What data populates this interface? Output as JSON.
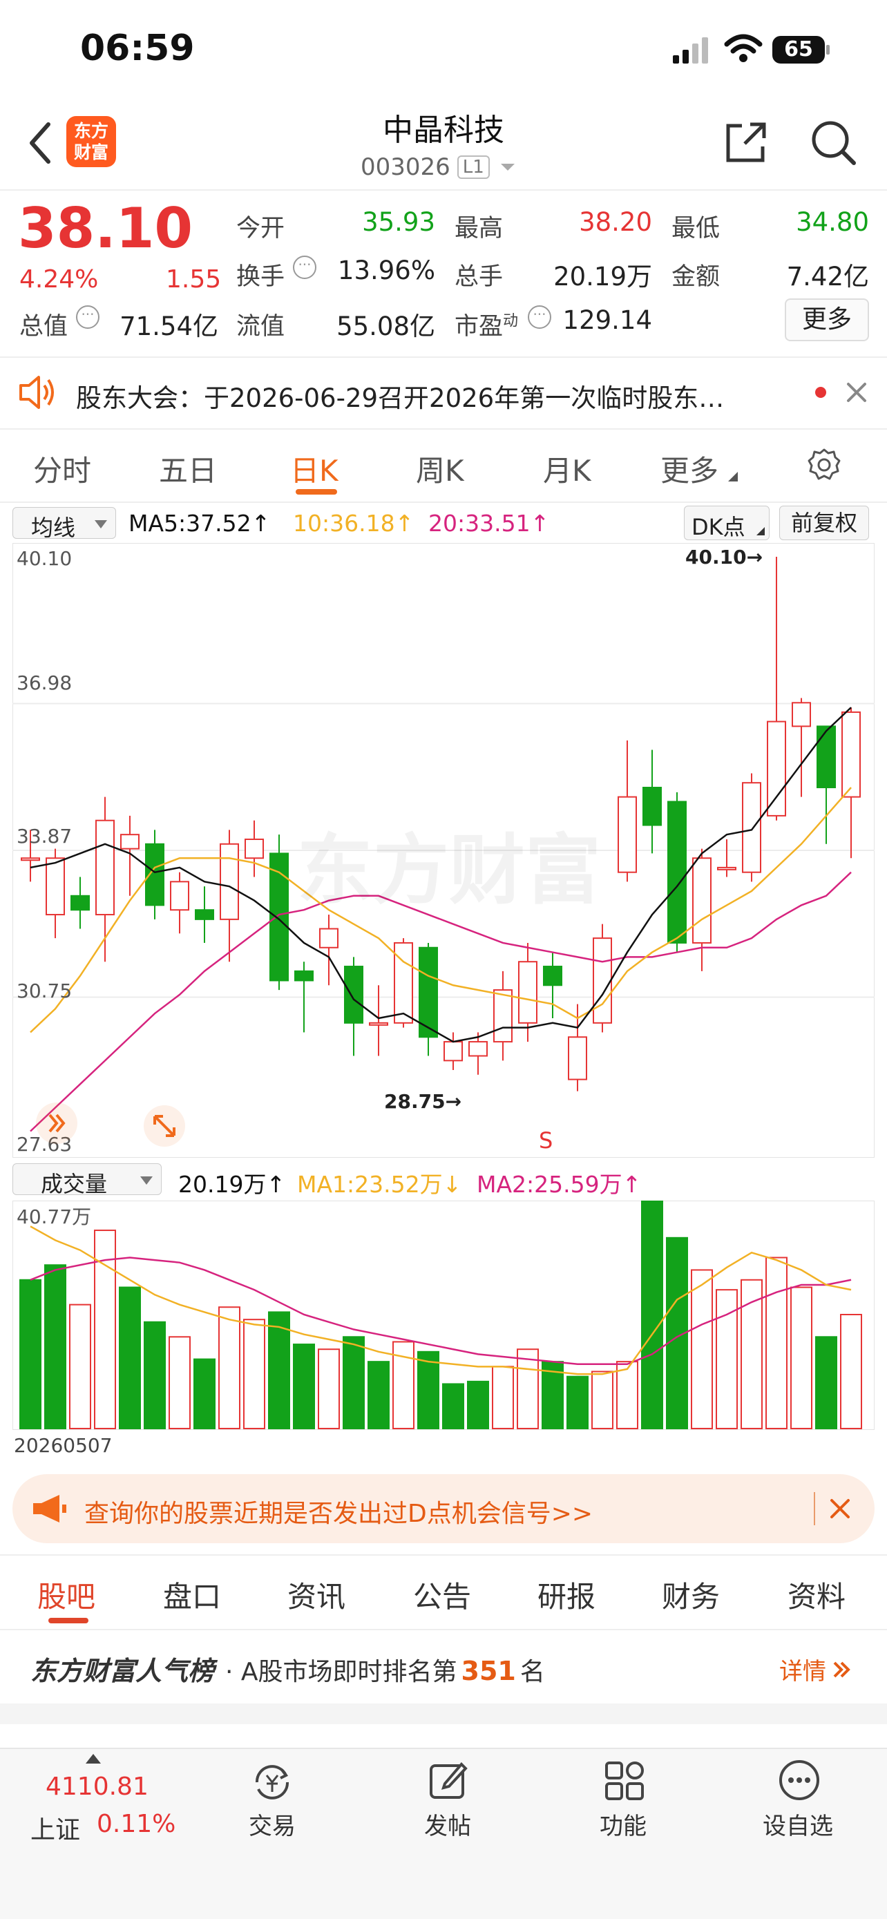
{
  "status_bar": {
    "time": "06:59",
    "battery": "65"
  },
  "header": {
    "logo_text": "东方\n财富",
    "title": "中晶科技",
    "code": "003026",
    "level_badge": "L1"
  },
  "quote": {
    "price": "38.10",
    "change_pct": "4.24%",
    "change": "1.55",
    "open_label": "今开",
    "open_value": "35.93",
    "high_label": "最高",
    "high_value": "38.20",
    "low_label": "最低",
    "low_value": "34.80",
    "turnover_label": "换手",
    "turnover_value": "13.96%",
    "volume_label": "总手",
    "volume_value": "20.19万",
    "amount_label": "金额",
    "amount_value": "7.42亿",
    "mktcap_label": "总值",
    "mktcap_value": "71.54亿",
    "float_label": "流值",
    "float_value": "55.08亿",
    "pe_label": "市盈",
    "pe_sup": "动",
    "pe_value": "129.14",
    "more_button": "更多"
  },
  "notice": {
    "text": "股东大会：于2026-06-29召开2026年第一次临时股东…"
  },
  "chart_tabs": {
    "items": [
      "分时",
      "五日",
      "日K",
      "周K",
      "月K",
      "更多"
    ],
    "active": "日K"
  },
  "ma_legend": {
    "selector": "均线",
    "ma5": "MA5:37.52↑",
    "ma10": "10:36.18↑",
    "ma20": "20:33.51↑",
    "dk_button": "DK点",
    "adjust_button": "前复权"
  },
  "price_axis": [
    "40.10",
    "36.98",
    "33.87",
    "30.75",
    "27.63"
  ],
  "annotations": {
    "high_mark": "40.10→",
    "low_mark": "28.75→",
    "signal": "S",
    "watermark": "东方财富"
  },
  "volume_legend": {
    "selector": "成交量",
    "vol": "20.19万↑",
    "ma1": "MA1:23.52万↓",
    "ma2": "MA2:25.59万↑",
    "max_label": "40.77万",
    "date_label": "20260507"
  },
  "colors": {
    "up": "#e63434",
    "down": "#12a21a",
    "ma5": "#111111",
    "ma10": "#f2b125",
    "ma20": "#d6237e",
    "accent": "#ff5a00"
  },
  "chart_data": {
    "type": "candlestick",
    "ylim": [
      27.63,
      40.1
    ],
    "candles": [
      {
        "o": 33.7,
        "c": 33.7,
        "h": 34.3,
        "l": 33.2
      },
      {
        "o": 32.5,
        "c": 33.7,
        "h": 33.9,
        "l": 32.0
      },
      {
        "o": 32.9,
        "c": 32.6,
        "h": 33.3,
        "l": 32.2
      },
      {
        "o": 32.5,
        "c": 34.5,
        "h": 35.0,
        "l": 31.5
      },
      {
        "o": 33.9,
        "c": 34.2,
        "h": 34.6,
        "l": 32.9
      },
      {
        "o": 34.0,
        "c": 32.7,
        "h": 34.3,
        "l": 32.4
      },
      {
        "o": 32.6,
        "c": 33.2,
        "h": 33.4,
        "l": 32.1
      },
      {
        "o": 32.6,
        "c": 32.4,
        "h": 33.1,
        "l": 31.9
      },
      {
        "o": 32.4,
        "c": 34.0,
        "h": 34.3,
        "l": 31.5
      },
      {
        "o": 33.7,
        "c": 34.1,
        "h": 34.5,
        "l": 33.3
      },
      {
        "o": 33.8,
        "c": 31.1,
        "h": 34.2,
        "l": 30.9
      },
      {
        "o": 31.3,
        "c": 31.1,
        "h": 31.5,
        "l": 30.0
      },
      {
        "o": 31.8,
        "c": 32.2,
        "h": 32.5,
        "l": 31.0
      },
      {
        "o": 31.4,
        "c": 30.2,
        "h": 31.6,
        "l": 29.5
      },
      {
        "o": 30.2,
        "c": 30.2,
        "h": 31.0,
        "l": 29.5
      },
      {
        "o": 30.2,
        "c": 31.9,
        "h": 32.0,
        "l": 30.1
      },
      {
        "o": 31.8,
        "c": 29.9,
        "h": 31.9,
        "l": 29.5
      },
      {
        "o": 29.4,
        "c": 29.8,
        "h": 30.0,
        "l": 29.2
      },
      {
        "o": 29.5,
        "c": 29.8,
        "h": 30.0,
        "l": 29.1
      },
      {
        "o": 29.8,
        "c": 30.9,
        "h": 31.3,
        "l": 29.4
      },
      {
        "o": 30.2,
        "c": 31.5,
        "h": 31.9,
        "l": 29.8
      },
      {
        "o": 31.4,
        "c": 31.0,
        "h": 31.7,
        "l": 30.3
      },
      {
        "o": 29.0,
        "c": 29.9,
        "h": 30.6,
        "l": 28.75
      },
      {
        "o": 30.2,
        "c": 32.0,
        "h": 32.3,
        "l": 30.0
      },
      {
        "o": 33.4,
        "c": 35.0,
        "h": 36.2,
        "l": 33.2
      },
      {
        "o": 35.2,
        "c": 34.4,
        "h": 36.0,
        "l": 33.8
      },
      {
        "o": 34.9,
        "c": 31.9,
        "h": 35.1,
        "l": 31.7
      },
      {
        "o": 31.9,
        "c": 33.7,
        "h": 33.9,
        "l": 31.3
      },
      {
        "o": 33.5,
        "c": 33.5,
        "h": 34.1,
        "l": 33.3
      },
      {
        "o": 33.4,
        "c": 35.3,
        "h": 35.5,
        "l": 33.2
      },
      {
        "o": 34.6,
        "c": 36.6,
        "h": 40.1,
        "l": 34.5
      },
      {
        "o": 36.5,
        "c": 37.0,
        "h": 37.1,
        "l": 35.0
      },
      {
        "o": 36.5,
        "c": 35.2,
        "h": 36.5,
        "l": 34.0
      },
      {
        "o": 35.0,
        "c": 36.8,
        "h": 36.9,
        "l": 33.7
      }
    ],
    "volumes": [
      {
        "v": 30.0,
        "up": false
      },
      {
        "v": 33.0,
        "up": false
      },
      {
        "v": 25.0,
        "up": true
      },
      {
        "v": 40.0,
        "up": true
      },
      {
        "v": 28.5,
        "up": false
      },
      {
        "v": 21.5,
        "up": false
      },
      {
        "v": 18.5,
        "up": true
      },
      {
        "v": 14.0,
        "up": false
      },
      {
        "v": 24.5,
        "up": true
      },
      {
        "v": 22.0,
        "up": true
      },
      {
        "v": 23.5,
        "up": false
      },
      {
        "v": 17.0,
        "up": false
      },
      {
        "v": 16.0,
        "up": true
      },
      {
        "v": 18.5,
        "up": false
      },
      {
        "v": 13.5,
        "up": false
      },
      {
        "v": 17.5,
        "up": true
      },
      {
        "v": 15.5,
        "up": false
      },
      {
        "v": 9.0,
        "up": false
      },
      {
        "v": 9.5,
        "up": false
      },
      {
        "v": 12.5,
        "up": true
      },
      {
        "v": 16.0,
        "up": true
      },
      {
        "v": 13.5,
        "up": false
      },
      {
        "v": 10.5,
        "up": false
      },
      {
        "v": 11.5,
        "up": true
      },
      {
        "v": 13.5,
        "up": true
      },
      {
        "v": 46.0,
        "up": false
      },
      {
        "v": 38.5,
        "up": false
      },
      {
        "v": 32.0,
        "up": true
      },
      {
        "v": 28.0,
        "up": true
      },
      {
        "v": 30.0,
        "up": true
      },
      {
        "v": 34.5,
        "up": true
      },
      {
        "v": 28.5,
        "up": true
      },
      {
        "v": 18.5,
        "up": false
      },
      {
        "v": 23.0,
        "up": true
      }
    ],
    "ma5": [
      33.5,
      33.6,
      33.8,
      34.0,
      33.8,
      33.4,
      33.5,
      33.2,
      33.1,
      32.8,
      32.4,
      31.9,
      31.6,
      30.7,
      30.3,
      30.4,
      30.1,
      29.8,
      29.9,
      30.1,
      30.1,
      30.2,
      30.1,
      30.8,
      31.7,
      32.5,
      33.1,
      33.8,
      34.2,
      34.3,
      35.0,
      35.7,
      36.4,
      36.9
    ],
    "ma10": [
      30.0,
      30.5,
      31.2,
      32.0,
      32.8,
      33.5,
      33.7,
      33.7,
      33.7,
      33.6,
      33.4,
      33.0,
      32.6,
      32.3,
      32.0,
      31.5,
      31.2,
      31.0,
      30.9,
      30.8,
      30.7,
      30.6,
      30.3,
      30.6,
      31.3,
      31.7,
      32.0,
      32.4,
      32.7,
      33.0,
      33.5,
      34.0,
      34.6,
      35.2
    ],
    "ma20": [
      27.9,
      28.4,
      28.9,
      29.4,
      29.9,
      30.4,
      30.8,
      31.3,
      31.7,
      32.1,
      32.5,
      32.6,
      32.8,
      32.9,
      32.9,
      32.7,
      32.5,
      32.3,
      32.1,
      31.9,
      31.8,
      31.7,
      31.6,
      31.5,
      31.6,
      31.6,
      31.7,
      31.8,
      31.8,
      32.0,
      32.4,
      32.7,
      32.9,
      33.4
    ],
    "vol_ma1": [
      40.8,
      38.0,
      36.0,
      33.0,
      30.0,
      27.0,
      25.0,
      23.5,
      22.0,
      21.0,
      20.5,
      19.0,
      18.0,
      17.0,
      15.5,
      14.5,
      13.5,
      13.0,
      12.5,
      12.5,
      12.0,
      11.5,
      11.0,
      11.0,
      12.0,
      19.0,
      26.0,
      29.0,
      32.5,
      35.5,
      34.0,
      32.0,
      29.0,
      28.0
    ],
    "vol_ma2": [
      30.0,
      32.0,
      33.0,
      34.0,
      34.5,
      34.0,
      33.5,
      32.0,
      30.0,
      28.0,
      25.5,
      23.0,
      21.5,
      20.0,
      19.0,
      18.0,
      17.0,
      16.0,
      15.0,
      14.5,
      14.0,
      13.5,
      13.0,
      13.0,
      13.0,
      15.0,
      18.5,
      21.0,
      23.0,
      25.5,
      27.5,
      29.0,
      29.0,
      30.0
    ],
    "vol_ylim": [
      0,
      46.0
    ]
  },
  "ad_banner": {
    "text": "查询你的股票近期是否发出过D点机会信号>>"
  },
  "bottom_tabs": {
    "items": [
      "股吧",
      "盘口",
      "资讯",
      "公告",
      "研报",
      "财务",
      "资料"
    ],
    "active": "股吧"
  },
  "popularity": {
    "brand": "东方财富人气榜",
    "prefix": "· A股市场即时排名第",
    "rank": "351",
    "suffix": "名",
    "detail": "详情"
  },
  "bottom_nav": {
    "index_value": "4110.81",
    "index_name": "上证",
    "index_change": "0.11%",
    "trade": "交易",
    "post": "发帖",
    "function": "功能",
    "watchlist": "设自选"
  }
}
